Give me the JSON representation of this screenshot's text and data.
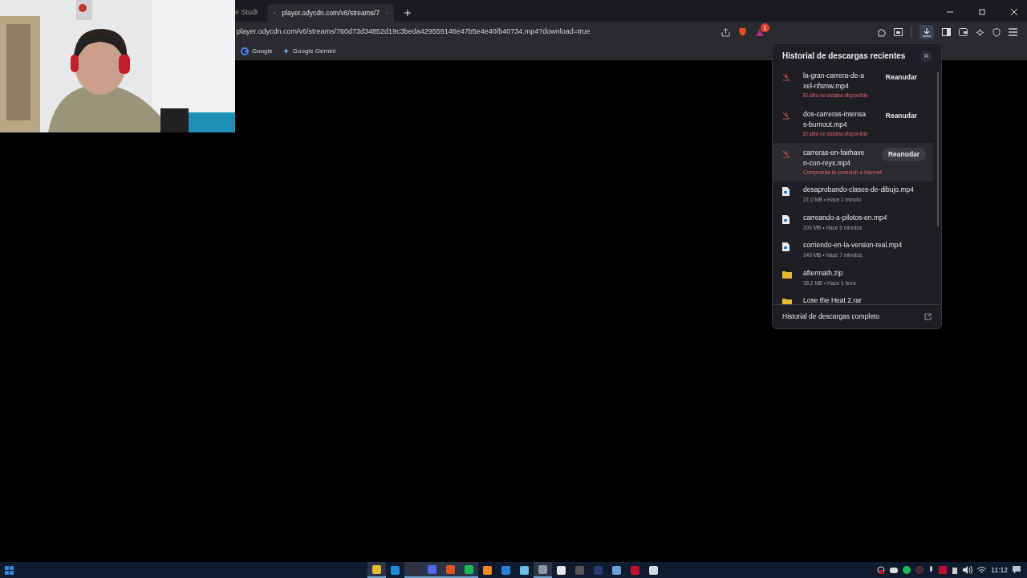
{
  "tabs": [
    {
      "title": "e Studi",
      "selected": false
    },
    {
      "title": "player.odycdn.com/v6/streams/7",
      "selected": true
    }
  ],
  "address_bar": {
    "url": "player.odycdn.com/v6/streams/760d73d34852d19c3beda429559146e47b5e4e40/b40734.mp4?download=true"
  },
  "extension_badge": "1",
  "bookmarks": [
    {
      "label": "Google",
      "kind": "google"
    },
    {
      "label": "Google Gemini",
      "kind": "gemini"
    }
  ],
  "downloads_panel": {
    "title": "Historial de descargas recientes",
    "items": [
      {
        "kind": "failed",
        "name": "la-gran-carrera-de-axel-nfsmw.mp4",
        "status": "El sitio no estaba disponible",
        "action": "Reanudar",
        "selected": false
      },
      {
        "kind": "failed",
        "name": "dos-carreras-intensas-burnout.mp4",
        "status": "El sitio no estaba disponible",
        "action": "Reanudar",
        "selected": false
      },
      {
        "kind": "failed",
        "name": "carreras-en-fairhaven-con-reyx.mp4",
        "status": "Comprueba la conexión a Internet",
        "action": "Reanudar",
        "selected": true
      },
      {
        "kind": "file",
        "name": "desaprobando-clases-de-dibujo.mp4",
        "status": "27,0 MB • Hace 1 minuto",
        "selected": false
      },
      {
        "kind": "file",
        "name": "carreando-a-pilotos-en.mp4",
        "status": "209 MB • Hace 6 minutos",
        "selected": false
      },
      {
        "kind": "file",
        "name": "corriendo-en-la-version-real.mp4",
        "status": "149 MB • Hace 7 minutos",
        "selected": false
      },
      {
        "kind": "folder",
        "name": "aftermath.zip",
        "status": "38,2 MB • Hace 1 hora",
        "selected": false
      },
      {
        "kind": "folder",
        "name": "Lose the Heat 2.rar",
        "selected": false
      }
    ],
    "footer": "Historial de descargas completo"
  },
  "taskbar": {
    "apps": [
      {
        "kind": "explorer",
        "selected": true
      },
      {
        "kind": "blue",
        "selected": false
      },
      {
        "kind": "obs",
        "selected": true
      },
      {
        "kind": "discord",
        "selected": true
      },
      {
        "kind": "brave",
        "selected": true
      },
      {
        "kind": "spotify",
        "selected": true
      },
      {
        "kind": "orange",
        "selected": false
      },
      {
        "kind": "photos",
        "selected": false
      },
      {
        "kind": "notepad",
        "selected": false
      },
      {
        "kind": "audio",
        "selected": true
      },
      {
        "kind": "white",
        "selected": false
      },
      {
        "kind": "monitor",
        "selected": false
      },
      {
        "kind": "ps",
        "selected": false
      },
      {
        "kind": "blue2",
        "selected": false
      },
      {
        "kind": "red",
        "selected": false
      },
      {
        "kind": "doc",
        "selected": false
      }
    ],
    "clock": "11:12"
  }
}
